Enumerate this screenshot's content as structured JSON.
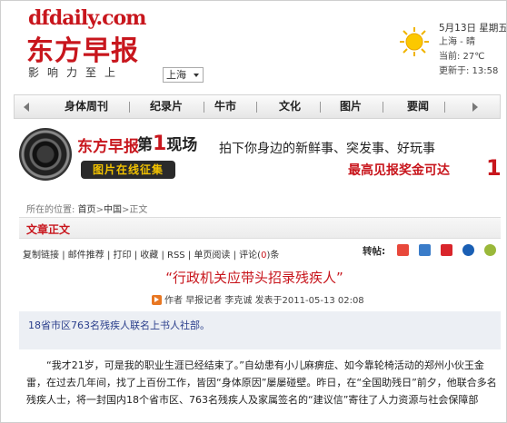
{
  "header": {
    "logo_url_text": "dfdaily.com",
    "logo_cn_text": "东方早报",
    "slogan": "影响力至上",
    "region_select": "上海",
    "weather": {
      "date": "5月13日 星期五",
      "city_condition": "上海 - 晴",
      "temperature": "当前: 27℃",
      "updated": "更新于: 13:58",
      "icon": "sun-icon"
    }
  },
  "nav": {
    "items": [
      "身体周刊",
      "纪录片",
      "牛市",
      "文化",
      "图片",
      "要闻"
    ],
    "prev_icon": "chevron-left-icon",
    "next_icon": "chevron-right-icon"
  },
  "banner": {
    "brand": "东方早报",
    "first_label": "第",
    "first_number": "1",
    "first_suffix": "现场",
    "pill": "图片在线征集",
    "tagline": "拍下你身边的新鲜事、突发事、好玩事",
    "reward": "最高见报奖金可达",
    "reward_amount": "1"
  },
  "breadcrumb": {
    "prefix": "所在的位置:",
    "items": [
      "首页",
      "中国",
      "正文"
    ],
    "sep": ">"
  },
  "section": {
    "title": "文章正文"
  },
  "toolbar": {
    "copy": "复制链接",
    "email": "邮件推荐",
    "print": "打印",
    "favorite": "收藏",
    "rss": "RSS",
    "single_page": "单页阅读",
    "comments_label": "评论(",
    "comments_count": "0",
    "comments_suffix": ")条",
    "share_label": "转帖:"
  },
  "article": {
    "title": "“行政机关应带头招录残疾人”",
    "byline_author_label": "作者",
    "byline_author": "早报记者 李克诚",
    "byline_time": "发表于2011-05-13 02:08",
    "summary": "18省市区763名残疾人联名上书人社部。",
    "body": "“我才21岁，可是我的职业生涯已经结束了。”自幼患有小儿麻痹症、如今靠轮椅活动的郑州小伙王金雷，在过去几年间，找了上百份工作，皆因“身体原因”屡屡碰壁。昨日，在“全国助残日”前夕，他联合多名残疾人士，将一封国内18个省市区、763名残疾人及家属签名的“建议信”寄往了人力资源与社会保障部"
  },
  "colors": {
    "brand_red": "#c8161d",
    "summary_blue": "#2b3f8c",
    "summary_bg": "#eceff4"
  }
}
